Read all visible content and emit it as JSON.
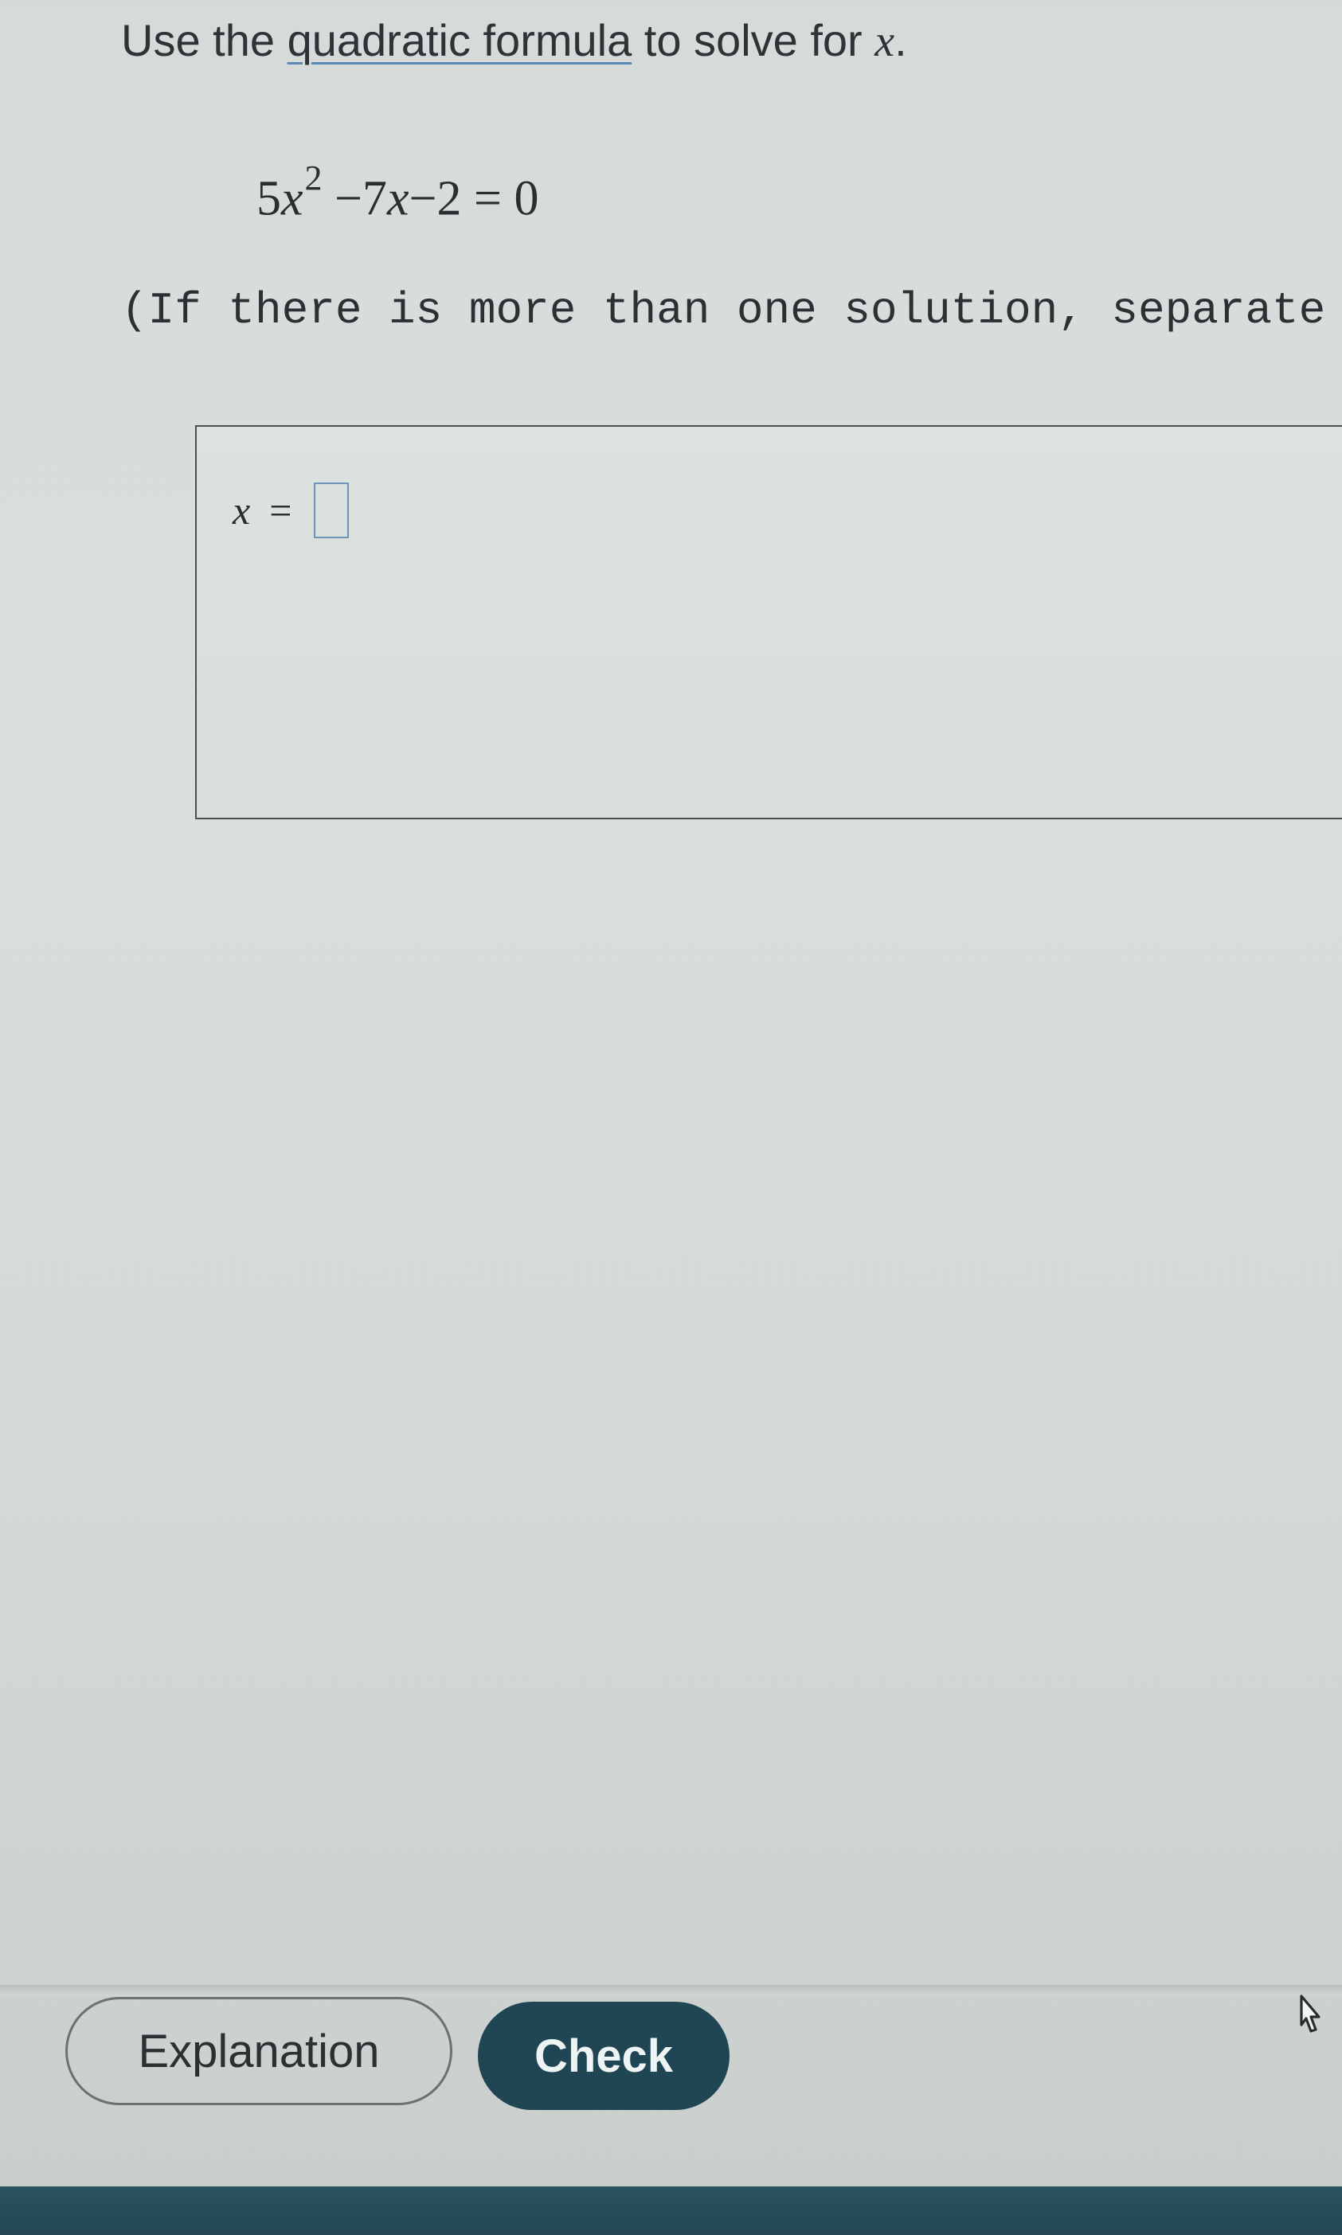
{
  "problem": {
    "prompt_before": "Use the ",
    "prompt_link": "quadratic formula",
    "prompt_after": " to solve for ",
    "prompt_var": "x",
    "prompt_end": ".",
    "equation": {
      "coef_a": "5",
      "var": "x",
      "exponent": "2",
      "rest_b": " −7",
      "rest_var": "x",
      "rest_c": "−2 = 0"
    },
    "instruction": "(If there is more than one solution, separate them"
  },
  "answer": {
    "variable": "x",
    "equals": "=",
    "input_value": ""
  },
  "buttons": {
    "explanation": "Explanation",
    "check": "Check"
  },
  "colors": {
    "check_bg": "#1f4652",
    "link_underline": "#5b8bb5",
    "input_border": "#6f94b8",
    "bottom_bar": "#234652"
  },
  "icons": {
    "cursor": "hand-pointer-icon"
  }
}
